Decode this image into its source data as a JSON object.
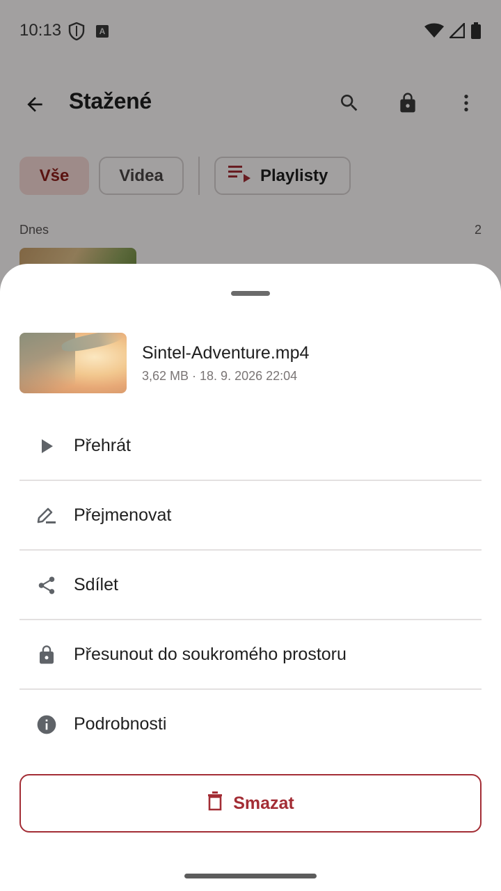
{
  "status_bar": {
    "time": "10:13",
    "icons": [
      "shield-icon",
      "a-badge-icon",
      "wifi-icon",
      "cellular-icon",
      "battery-icon"
    ]
  },
  "app_bar": {
    "title": "Stažené",
    "actions": [
      "back-arrow-icon",
      "search-icon",
      "lock-icon",
      "more-vert-icon"
    ]
  },
  "chips": {
    "all": "Vše",
    "videos": "Videa",
    "playlists": "Playlisty"
  },
  "section": {
    "label": "Dnes",
    "count": "2"
  },
  "sheet": {
    "file": {
      "name": "Sintel-Adventure.mp4",
      "meta": "3,62 MB · 18. 9. 2026 22:04"
    },
    "menu": [
      {
        "label": "Přehrát",
        "icon": "play-icon"
      },
      {
        "label": "Přejmenovat",
        "icon": "edit-icon"
      },
      {
        "label": "Sdílet",
        "icon": "share-icon"
      },
      {
        "label": "Přesunout do soukromého prostoru",
        "icon": "lock-icon"
      },
      {
        "label": "Podrobnosti",
        "icon": "info-icon"
      }
    ],
    "delete_label": "Smazat"
  },
  "colors": {
    "accent": "#a32d35",
    "chip_selected_bg": "#f7d9d6",
    "chip_selected_text": "#8e1f1a",
    "icon_gray": "#5f6368"
  }
}
